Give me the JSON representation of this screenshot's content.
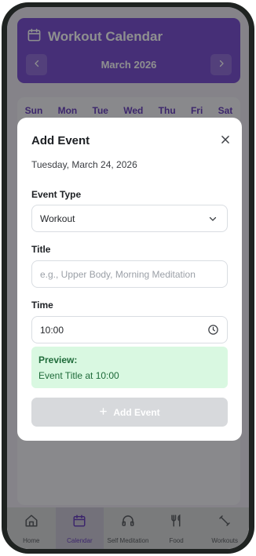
{
  "header": {
    "title": "Workout Calendar",
    "month": "March 2026"
  },
  "calendar": {
    "weekdays": [
      "Sun",
      "Mon",
      "Tue",
      "Wed",
      "Thu",
      "Fri",
      "Sat"
    ]
  },
  "modal": {
    "title": "Add Event",
    "date": "Tuesday, March 24, 2026",
    "event_type_label": "Event Type",
    "event_type_value": "Workout",
    "title_label": "Title",
    "title_placeholder": "e.g., Upper Body, Morning Meditation",
    "time_label": "Time",
    "time_value": "10:00",
    "preview_label": "Preview:",
    "preview_text": "Event Title at 10:00",
    "add_button": "Add Event"
  },
  "bottom_nav": {
    "items": [
      {
        "label": "Home",
        "icon": "home-icon"
      },
      {
        "label": "Calendar",
        "icon": "calendar-icon",
        "active": true
      },
      {
        "label": "Self Meditation",
        "icon": "headphones-icon"
      },
      {
        "label": "Food",
        "icon": "utensils-icon"
      },
      {
        "label": "Workouts",
        "icon": "dumbbell-icon"
      }
    ]
  },
  "colors": {
    "accent": "#6e3fcf",
    "preview_bg": "#d9f8e1",
    "preview_text": "#1f6b3a",
    "disabled_button": "#d7d9dc"
  }
}
